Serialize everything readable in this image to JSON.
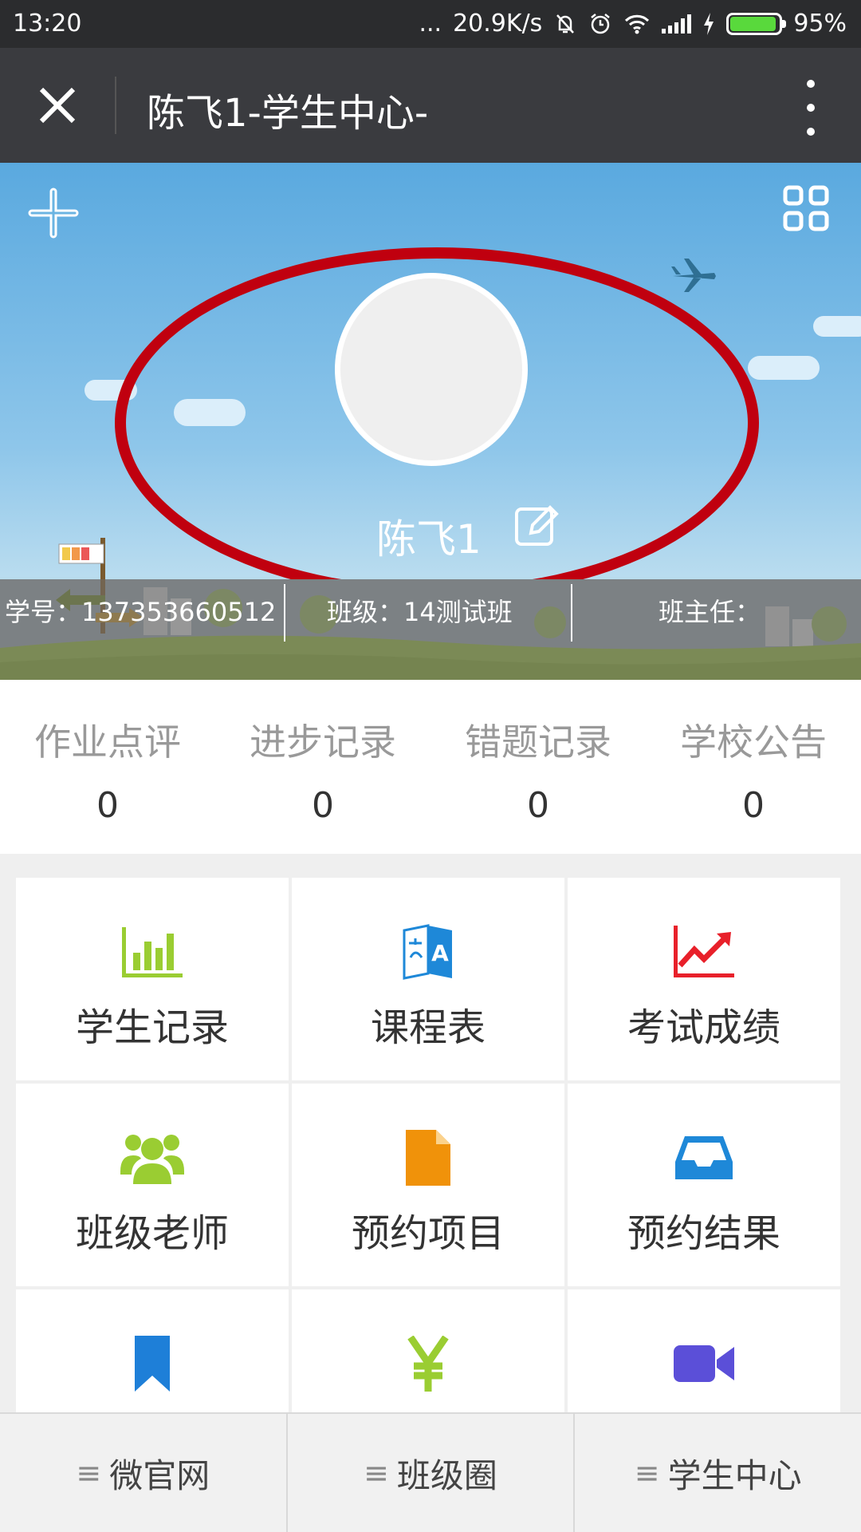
{
  "status_bar": {
    "time": "13:20",
    "dots": "...",
    "speed": "20.9K/s",
    "battery": "95%",
    "battery_level": 0.95,
    "battery_color": "#59d93c"
  },
  "title_bar": {
    "close_glyph": "✕",
    "title": "陈飞1-学生中心-"
  },
  "profile": {
    "name": "陈飞1",
    "student_id_label": "学号：",
    "student_id": "137353660512",
    "class_label": "班级：",
    "class_name": "14测试班",
    "teacher_label": "班主任："
  },
  "annotation_color": "#c0000f",
  "stats": [
    {
      "label": "作业点评",
      "value": "0"
    },
    {
      "label": "进步记录",
      "value": "0"
    },
    {
      "label": "错题记录",
      "value": "0"
    },
    {
      "label": "学校公告",
      "value": "0"
    }
  ],
  "menu": [
    {
      "label": "学生记录",
      "icon": "bar-chart-icon",
      "color": "#9acd32"
    },
    {
      "label": "课程表",
      "icon": "translate-icon",
      "color": "#1e88d8"
    },
    {
      "label": "考试成绩",
      "icon": "trend-up-icon",
      "color": "#e8202a"
    },
    {
      "label": "班级老师",
      "icon": "users-icon",
      "color": "#9acd32"
    },
    {
      "label": "预约项目",
      "icon": "file-icon",
      "color": "#f0920a"
    },
    {
      "label": "预约结果",
      "icon": "inbox-icon",
      "color": "#1e88d8"
    },
    {
      "label": "",
      "icon": "bookmark-icon",
      "color": "#1e7fd8"
    },
    {
      "label": "",
      "icon": "yen-icon",
      "color": "#9acd32"
    },
    {
      "label": "",
      "icon": "video-icon",
      "color": "#5b4fd8"
    }
  ],
  "bottom_nav": [
    {
      "icon": "≡",
      "label": "微官网"
    },
    {
      "icon": "≡",
      "label": "班级圈"
    },
    {
      "icon": "≡",
      "label": "学生中心"
    }
  ]
}
